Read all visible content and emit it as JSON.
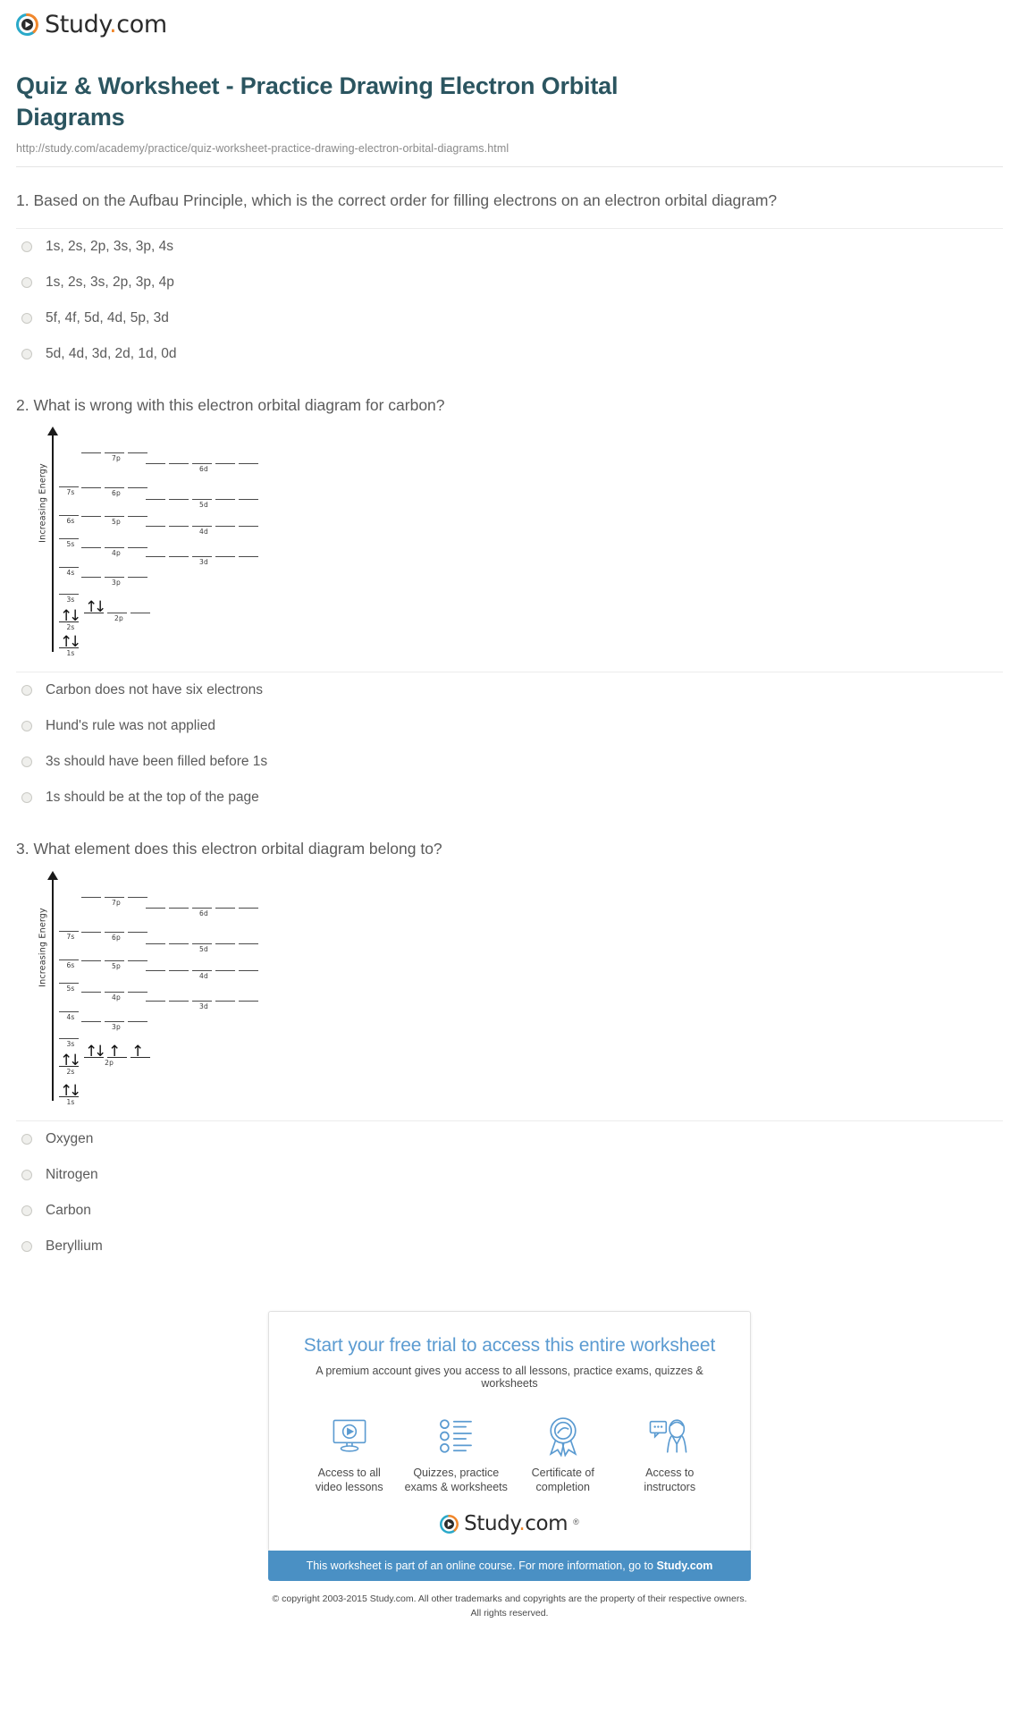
{
  "brand": {
    "name_main": "Study",
    "name_dot": ".",
    "name_tld": "com",
    "trademark": "®"
  },
  "header": {
    "title": "Quiz & Worksheet - Practice Drawing Electron Orbital Diagrams",
    "url": "http://study.com/academy/practice/quiz-worksheet-practice-drawing-electron-orbital-diagrams.html"
  },
  "questions": [
    {
      "number": "1.",
      "text": "1. Based on the Aufbau Principle, which is the correct order for filling electrons on an electron orbital diagram?",
      "options": [
        "1s, 2s, 2p, 3s, 3p, 4s",
        "1s, 2s, 3s, 2p, 3p, 4p",
        "5f, 4f, 5d, 4d, 5p, 3d",
        "5d, 4d, 3d, 2d, 1d, 0d"
      ]
    },
    {
      "number": "2.",
      "text": "2. What is wrong with this electron orbital diagram for carbon?",
      "options": [
        "Carbon does not have six electrons",
        "Hund's rule was not applied",
        "3s should have been filled before 1s",
        "1s should be at the top of the page"
      ]
    },
    {
      "number": "3.",
      "text": "3. What element does this electron orbital diagram belong to?",
      "options": [
        "Oxygen",
        "Nitrogen",
        "Carbon",
        "Beryllium"
      ]
    }
  ],
  "diagrams": {
    "axis_caption": "Increasing Energy",
    "carbon": {
      "labels": [
        "7p",
        "6d",
        "7s",
        "6p",
        "5d",
        "6s",
        "5p",
        "4d",
        "5s",
        "4p",
        "3d",
        "4s",
        "3p",
        "3s",
        "2s",
        "2p",
        "1s"
      ],
      "electrons": {
        "1s": [
          "updown"
        ],
        "2s": [
          "updown"
        ],
        "2p": [
          "updown",
          "empty",
          "empty"
        ]
      }
    },
    "oxygen": {
      "labels": [
        "7p",
        "6d",
        "7s",
        "6p",
        "5d",
        "6s",
        "5p",
        "4d",
        "5s",
        "4p",
        "3d",
        "4s",
        "3p",
        "3s",
        "2s",
        "2p",
        "1s"
      ],
      "electrons": {
        "1s": [
          "updown"
        ],
        "2s": [
          "updown"
        ],
        "2p": [
          "updown",
          "up",
          "up"
        ]
      }
    }
  },
  "promo": {
    "title": "Start your free trial to access this entire worksheet",
    "subtitle": "A premium account gives you access to all lessons, practice exams, quizzes & worksheets",
    "perks": [
      {
        "icon": "video-monitor-icon",
        "label": "Access to all\nvideo lessons"
      },
      {
        "icon": "checklist-icon",
        "label": "Quizzes, practice\nexams & worksheets"
      },
      {
        "icon": "certificate-ribbon-icon",
        "label": "Certificate of\ncompletion"
      },
      {
        "icon": "instructor-chat-icon",
        "label": "Access to\ninstructors"
      }
    ],
    "banner_prefix": "This worksheet is part of an online course. For more information, go to ",
    "banner_link": "Study.com"
  },
  "footer": {
    "copyright_line1": "© copyright 2003-2015 Study.com. All other trademarks and copyrights are the property of their respective owners.",
    "copyright_line2": "All rights reserved."
  }
}
